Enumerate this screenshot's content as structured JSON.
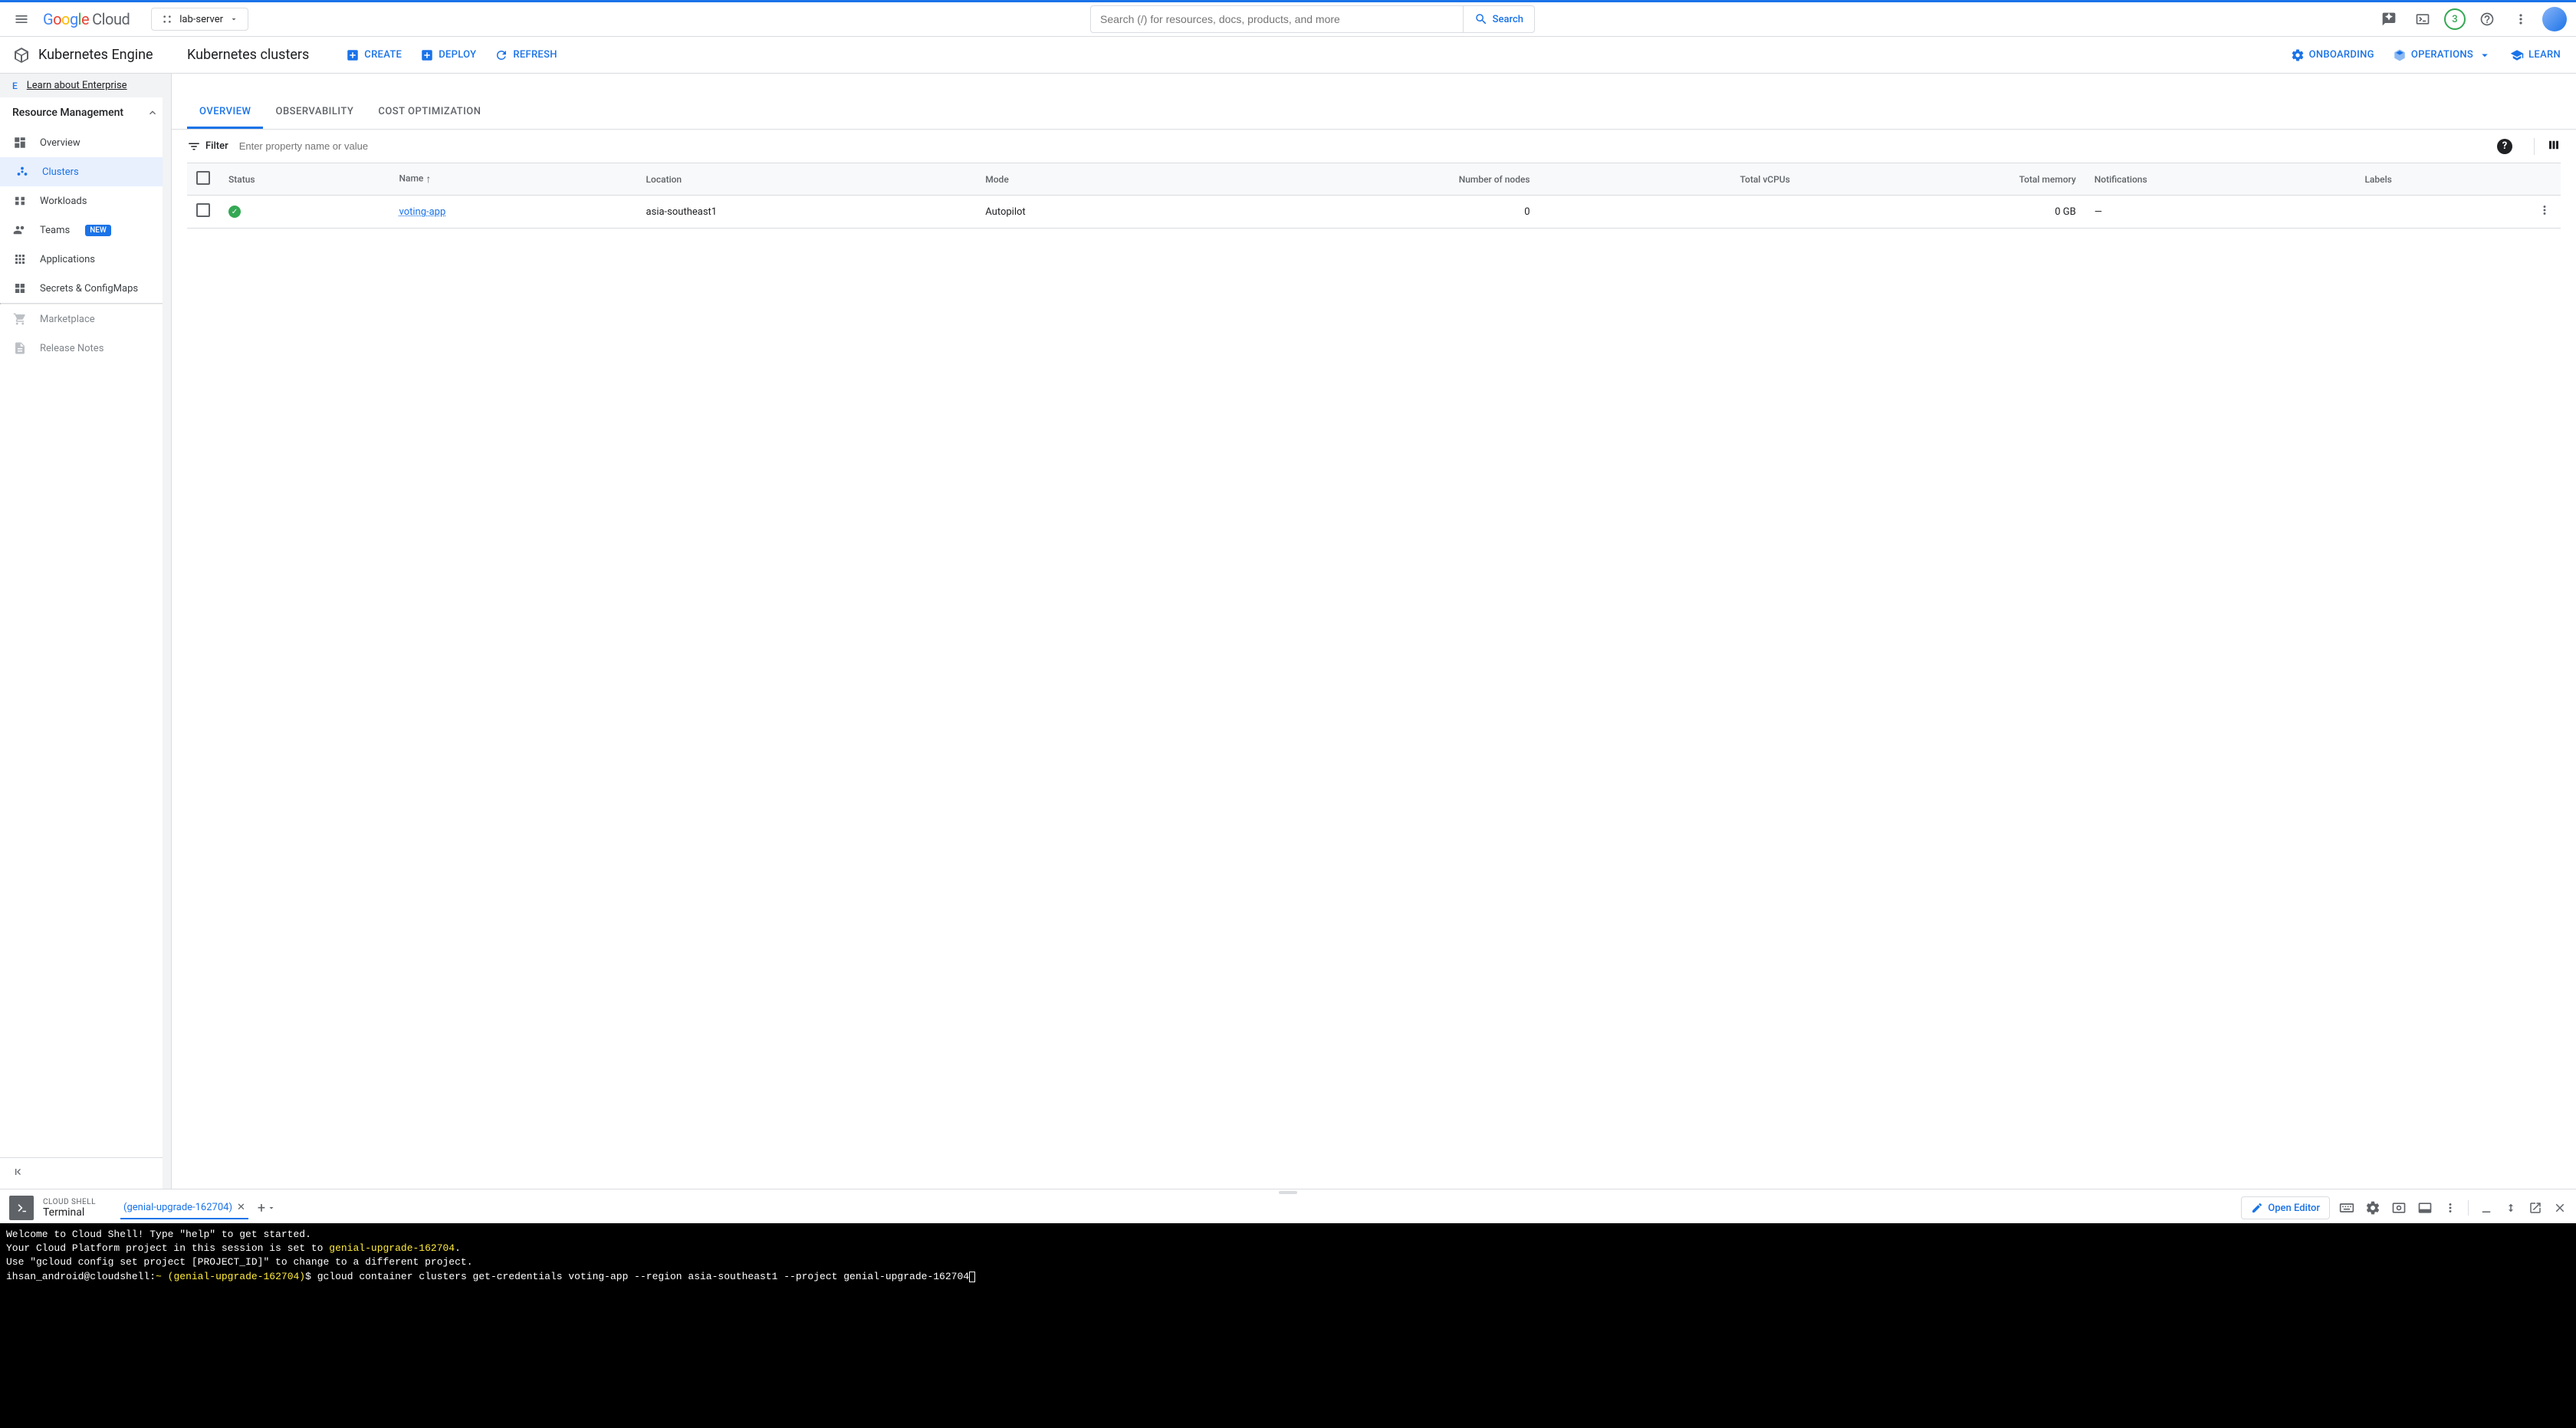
{
  "header": {
    "logo_cloud": "Cloud",
    "project_name": "lab-server",
    "search_placeholder": "Search (/) for resources, docs, products, and more",
    "search_button": "Search",
    "trial_count": "3"
  },
  "sub_header": {
    "product": "Kubernetes Engine",
    "page_title": "Kubernetes clusters",
    "actions": {
      "create": "CREATE",
      "deploy": "DEPLOY",
      "refresh": "REFRESH",
      "onboarding": "ONBOARDING",
      "operations": "OPERATIONS",
      "learn": "LEARN"
    }
  },
  "sidebar": {
    "enterprise_badge": "E",
    "enterprise_link": "Learn about Enterprise",
    "section_label": "Resource Management",
    "items": {
      "overview": "Overview",
      "clusters": "Clusters",
      "workloads": "Workloads",
      "teams": "Teams",
      "teams_badge": "NEW",
      "applications": "Applications",
      "secrets": "Secrets & ConfigMaps",
      "marketplace": "Marketplace",
      "release_notes": "Release Notes"
    }
  },
  "tabs": {
    "overview": "OVERVIEW",
    "observability": "OBSERVABILITY",
    "cost": "COST OPTIMIZATION"
  },
  "filter": {
    "label": "Filter",
    "placeholder": "Enter property name or value"
  },
  "table": {
    "headers": {
      "status": "Status",
      "name": "Name",
      "location": "Location",
      "mode": "Mode",
      "nodes": "Number of nodes",
      "vcpus": "Total vCPUs",
      "memory": "Total memory",
      "notifications": "Notifications",
      "labels": "Labels"
    },
    "rows": [
      {
        "name": "voting-app",
        "location": "asia-southeast1",
        "mode": "Autopilot",
        "nodes": "0",
        "vcpus": "",
        "memory": "0 GB",
        "notifications": "—",
        "labels": ""
      }
    ]
  },
  "terminal": {
    "label": "CLOUD SHELL",
    "title": "Terminal",
    "tab_name": "(genial-upgrade-162704)",
    "open_editor": "Open Editor",
    "lines": {
      "l1": "Welcome to Cloud Shell! Type \"help\" to get started.",
      "l2a": "Your Cloud Platform project in this session is set to ",
      "l2b": "genial-upgrade-162704",
      "l2c": ".",
      "l3": "Use \"gcloud config set project [PROJECT_ID]\" to change to a different project.",
      "l4a": "ihsan_android@cloudshell:",
      "l4b": "~",
      "l4c": " ",
      "l4d": "(genial-upgrade-162704)",
      "l4e": "$ gcloud container clusters get-credentials voting-app --region asia-southeast1 --project genial-upgrade-162704"
    }
  }
}
